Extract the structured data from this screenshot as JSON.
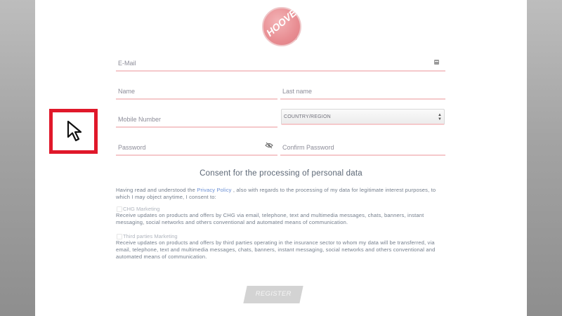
{
  "brand": {
    "logo_text": "HOOVER",
    "registered": "®"
  },
  "form": {
    "email_label": "E-Mail",
    "name_label": "Name",
    "lastname_label": "Last name",
    "mobile_label": "Mobile Number",
    "country_value": "COUNTRY/REGION",
    "password_label": "Password",
    "confirm_password_label": "Confirm Password"
  },
  "consent": {
    "title": "Consent for the processing of personal data",
    "intro_before": "Having read and understood the ",
    "intro_link": "Privacy Policy",
    "intro_after": " , also with regards to the processing of my data for legitimate interest purposes, to which I may object anytime, I consent to:",
    "chg_label": "CHG Marketing",
    "chg_text": "Receive updates on products and offers by CHG via email, telephone, text and multimedia messages, chats, banners, instant messaging, social networks and others conventional and automated means of communication.",
    "third_label": "Third parties Marketing",
    "third_text": "Receive updates on products and offers by third parties operating in the insurance sector to whom my data will be transferred, via email, telephone, text and multimedia messages, chats, banners, instant messaging, social networks and others conventional and automated means of communication."
  },
  "register_label": "REGISTER",
  "colors": {
    "accent": "#e0182a",
    "field_underline": "#f5c9cb",
    "link": "#6b8fd4",
    "logo": "#e88d92"
  },
  "icons": {
    "email_field": "calculator-icon",
    "password_field": "eye-slash-icon",
    "overlay": "mouse-pointer-icon"
  }
}
